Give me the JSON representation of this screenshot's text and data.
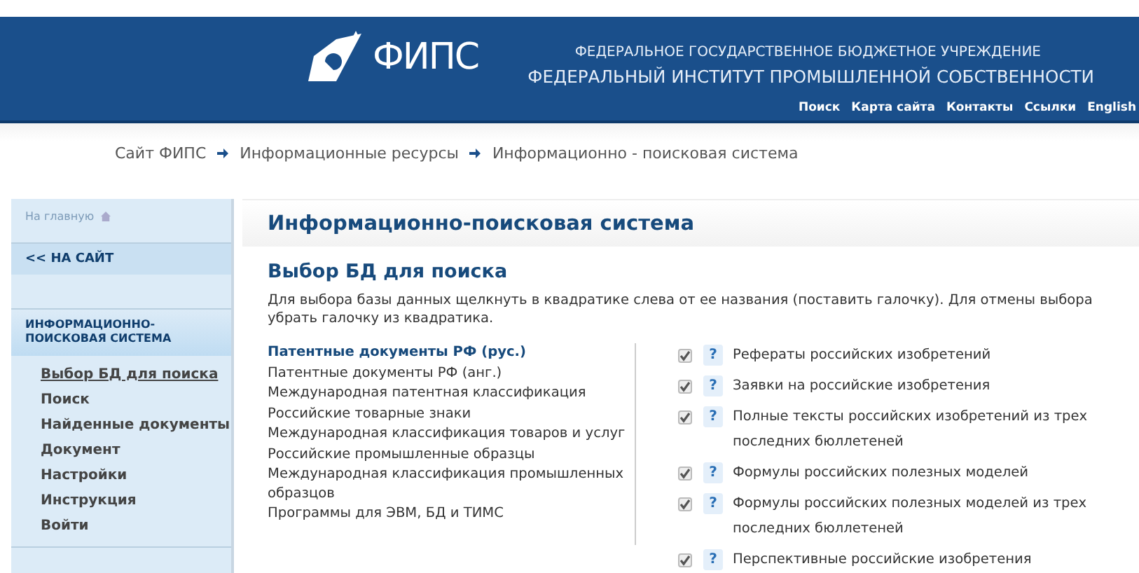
{
  "header": {
    "logo_text": "ФИПС",
    "subtitle": "ФЕДЕРАЛЬНОЕ ГОСУДАРСТВЕННОЕ БЮДЖЕТНОЕ УЧРЕЖДЕНИЕ",
    "title": "ФЕДЕРАЛЬНЫЙ ИНСТИТУТ ПРОМЫШЛЕННОЙ СОБСТВЕННОСТИ",
    "links": [
      "Поиск",
      "Карта сайта",
      "Контакты",
      "Ссылки",
      "English"
    ]
  },
  "breadcrumbs": [
    "Сайт ФИПС",
    "Информационные ресурсы",
    "Информационно - поисковая система"
  ],
  "sidebar": {
    "home_link": "На главную",
    "back_link": "<< НА САЙТ",
    "section_title": "ИНФОРМАЦИОННО-ПОИСКОВАЯ СИСТЕМА",
    "items": [
      {
        "label": "Выбор БД для поиска",
        "selected": true
      },
      {
        "label": "Поиск",
        "selected": false
      },
      {
        "label": "Найденные документы",
        "selected": false
      },
      {
        "label": "Документ",
        "selected": false
      },
      {
        "label": "Настройки",
        "selected": false
      },
      {
        "label": "Инструкция",
        "selected": false
      },
      {
        "label": "Войти",
        "selected": false
      }
    ]
  },
  "main": {
    "title": "Информационно-поисковая система",
    "subtitle": "Выбор БД для поиска",
    "description": "Для выбора базы данных щелкнуть в квадратике слева от ее названия (поставить галочку). Для отмены выбора убрать галочку из квадратика.",
    "categories": [
      {
        "label": "Патентные документы РФ (рус.)",
        "selected": true
      },
      {
        "label": "Патентные документы РФ (анг.)",
        "selected": false
      },
      {
        "label": "Международная патентная классификация",
        "selected": false
      },
      {
        "label": "Российские товарные знаки",
        "selected": false
      },
      {
        "label": "Международная классификация товаров и услуг",
        "selected": false
      },
      {
        "label": "Российские промышленные образцы",
        "selected": false
      },
      {
        "label": "Международная классификация промышленных образцов",
        "selected": false
      },
      {
        "label": "Программы для ЭВМ, БД и ТИМС",
        "selected": false
      }
    ],
    "databases": [
      {
        "help": "?",
        "label": "Рефераты российских изобретений",
        "checked": true
      },
      {
        "help": "?",
        "label": "Заявки на российские изобретения",
        "checked": true
      },
      {
        "help": "?",
        "label": "Полные тексты российских изобретений из трех последних бюллетеней",
        "checked": true
      },
      {
        "help": "?",
        "label": "Формулы российских полезных моделей",
        "checked": true
      },
      {
        "help": "?",
        "label": "Формулы российских полезных моделей из трех последних бюллетеней",
        "checked": true
      },
      {
        "help": "?",
        "label": "Перспективные российские изобретения",
        "checked": true
      }
    ]
  }
}
